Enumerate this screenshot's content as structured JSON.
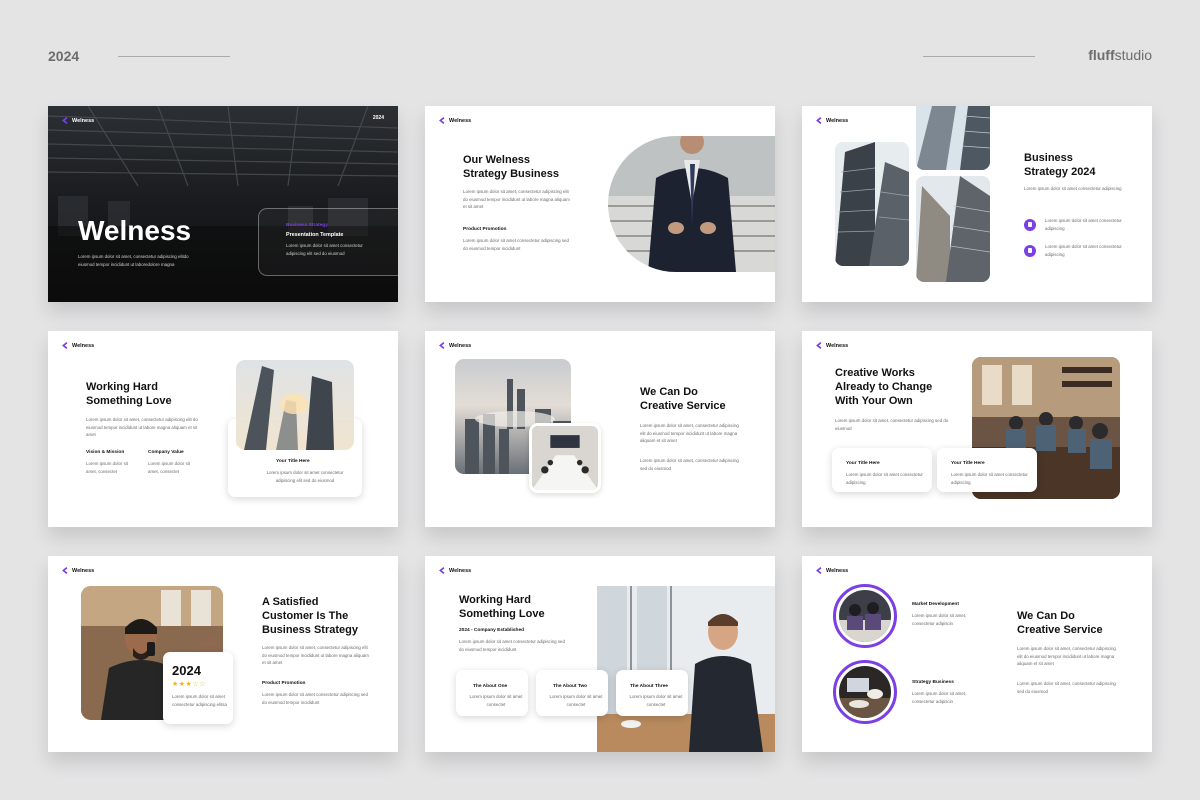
{
  "header": {
    "year": "2024",
    "brand_bold": "fluff",
    "brand_rest": "studio"
  },
  "logo_text": "Welness",
  "lorem": {
    "a": "Lorem ipsum dolor sit amet, consectetur adipiscing elit do eiusmod tempor incididunt ut labore magna aliquam et sit amet",
    "b": "Lorem ipsum dolor sit amet consectetur adipiscing sed do eiusmod tempor incididunt",
    "c": "Lorem ipsum dolor sit amet consectetur adipiscing",
    "d": "Lorem ipsum dolor sit amet, consectetur adipiscing sed do eiusmod",
    "e": "Lorem ipsum dolor sit amet, consectetur adipiscing elit"
  },
  "slides": {
    "s1": {
      "year": "2024",
      "title": "Welness",
      "body": "Lorem ipsum dolor sit amet, consectetur adipiscing elitdo eiusmod tempor incididunt ut laboredolore magna",
      "badge_label": "Business Strategy",
      "badge_title": "Presentation Template",
      "badge_body": "Lorem ipsum dolor sit amet consectetur adipiscing elit sed do eiusmod"
    },
    "s2": {
      "title_1": "Our Welness",
      "title_2": "Strategy Business",
      "subhead": "Product Promotion"
    },
    "s3": {
      "title_1": "Business",
      "title_2": "Strategy 2024"
    },
    "s4": {
      "title_1": "Working Hard",
      "title_2": "Something Love",
      "col1": "Vision & Mission",
      "col2": "Company Value",
      "col_body": "Lorem ipsum dolor sit amet, consectet",
      "card_title": "Your Title Here",
      "card_body": "Lorem ipsum dolor sit amet consectetur adipiscing elit sed do eiusmod"
    },
    "s5": {
      "title_1": "We Can Do",
      "title_2": "Creative Service"
    },
    "s6": {
      "title_1": "Creative Works",
      "title_2": "Already to Change",
      "title_3": "With Your Own",
      "card_title": "Your Title Here",
      "card_body": "Lorem ipsum dolor sit amet consectetur adipiscing"
    },
    "s7": {
      "title_1": "A Satisfied",
      "title_2": "Customer Is The",
      "title_3": "Business Strategy",
      "year": "2024",
      "stars": "★★★☆☆",
      "subhead": "Product Promotion",
      "card_body": "Lorem ipsum dolor sit amet consectetur adipiscing elitsa"
    },
    "s8": {
      "title_1": "Working Hard",
      "title_2": "Something Love",
      "subhead": "2024 - Company Established",
      "box1": "The About One",
      "box2": "The About Two",
      "box3": "The About Three",
      "box_body": "Lorem ipsum dolor sit amet consectet"
    },
    "s9": {
      "title_1": "We Can Do",
      "title_2": "Creative Service",
      "item1": "Market Development",
      "item2": "Strategy Business",
      "item_body": "Lorem ipsum dolor sit amet, consectetur adipiscin"
    }
  },
  "colors": {
    "accent": "#7b3fe4",
    "dark_slide": "#141416",
    "background": "#e4e4e5"
  }
}
